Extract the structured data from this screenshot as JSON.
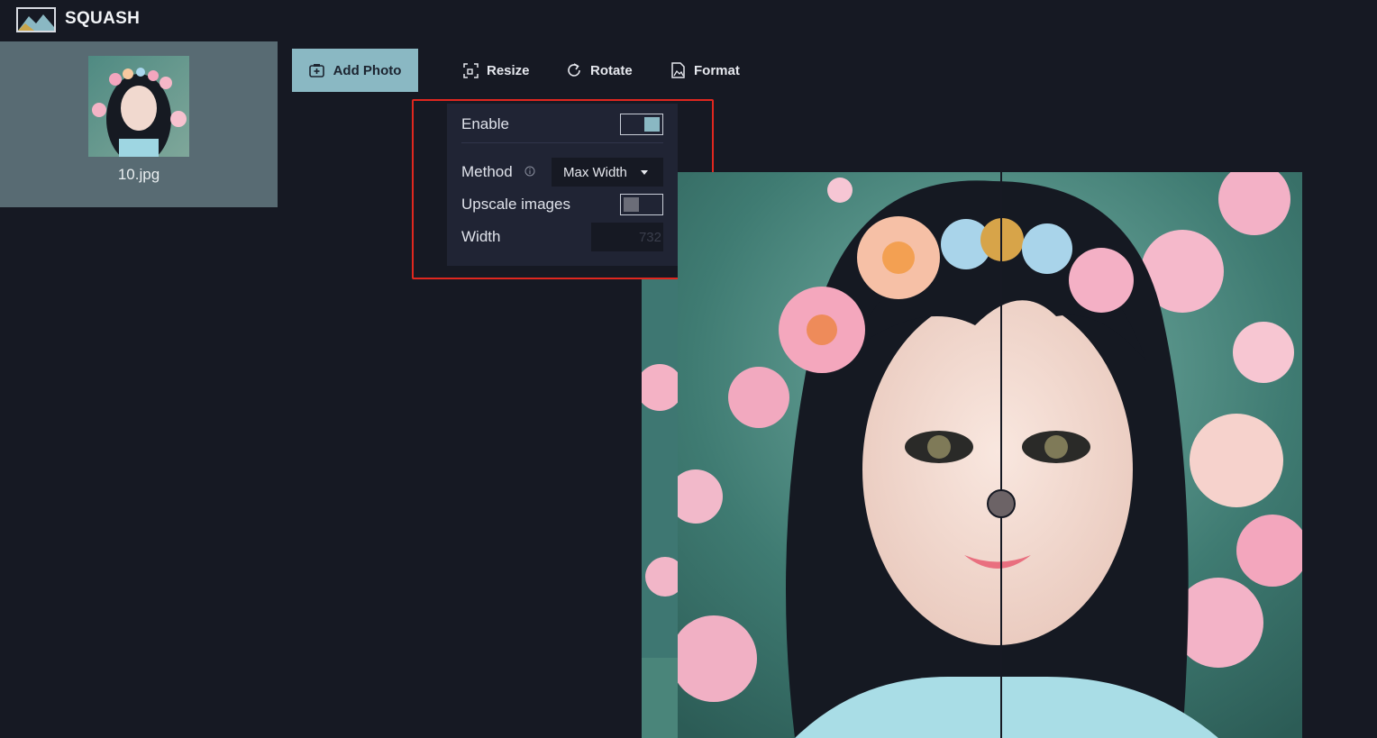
{
  "app": {
    "title": "SQUASH"
  },
  "file": {
    "name": "10.jpg"
  },
  "toolbar": {
    "add_photo": "Add Photo",
    "resize": "Resize",
    "rotate": "Rotate",
    "format": "Format"
  },
  "resize_panel": {
    "enable_label": "Enable",
    "enable_on": true,
    "method_label": "Method",
    "method_value": "Max Width",
    "upscale_label": "Upscale images",
    "upscale_on": false,
    "width_label": "Width",
    "width_value": "732"
  },
  "colors": {
    "background": "#161923",
    "accent": "#8ab8c3",
    "panel": "#202434",
    "highlight": "#e0271f"
  },
  "icons": [
    "logo-icon",
    "add-photo-icon",
    "resize-icon",
    "rotate-icon",
    "format-icon",
    "info-icon"
  ]
}
